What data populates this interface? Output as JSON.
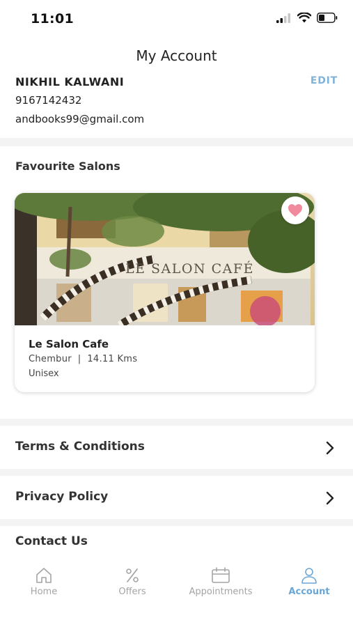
{
  "status_bar": {
    "time": "11:01"
  },
  "header": {
    "title": "My Account"
  },
  "profile": {
    "name": "NIKHIL KALWANI",
    "phone": "9167142432",
    "email": "andbooks99@gmail.com",
    "edit_label": "EDIT"
  },
  "favourites": {
    "title": "Favourite Salons",
    "salons": [
      {
        "name": "Le Salon Cafe",
        "area": "Chembur",
        "distance": "14.11 Kms",
        "meta": "Chembur  |  14.11 Kms",
        "type": "Unisex",
        "sign_text": "LE SALON CAFÉ",
        "favourited": true
      }
    ]
  },
  "menu": {
    "items": [
      {
        "label": "Terms & Conditions"
      },
      {
        "label": "Privacy Policy"
      },
      {
        "label": "Contact Us"
      }
    ]
  },
  "tab_bar": {
    "tabs": [
      {
        "label": "Home",
        "icon": "home-icon",
        "active": false
      },
      {
        "label": "Offers",
        "icon": "percent-icon",
        "active": false
      },
      {
        "label": "Appointments",
        "icon": "calendar-icon",
        "active": false
      },
      {
        "label": "Account",
        "icon": "user-icon",
        "active": true
      }
    ]
  },
  "colors": {
    "accent": "#6aa6d6",
    "edit": "#7fb3d8",
    "heart": "#f08a9c",
    "inactive_tab": "#a4a4a4"
  }
}
